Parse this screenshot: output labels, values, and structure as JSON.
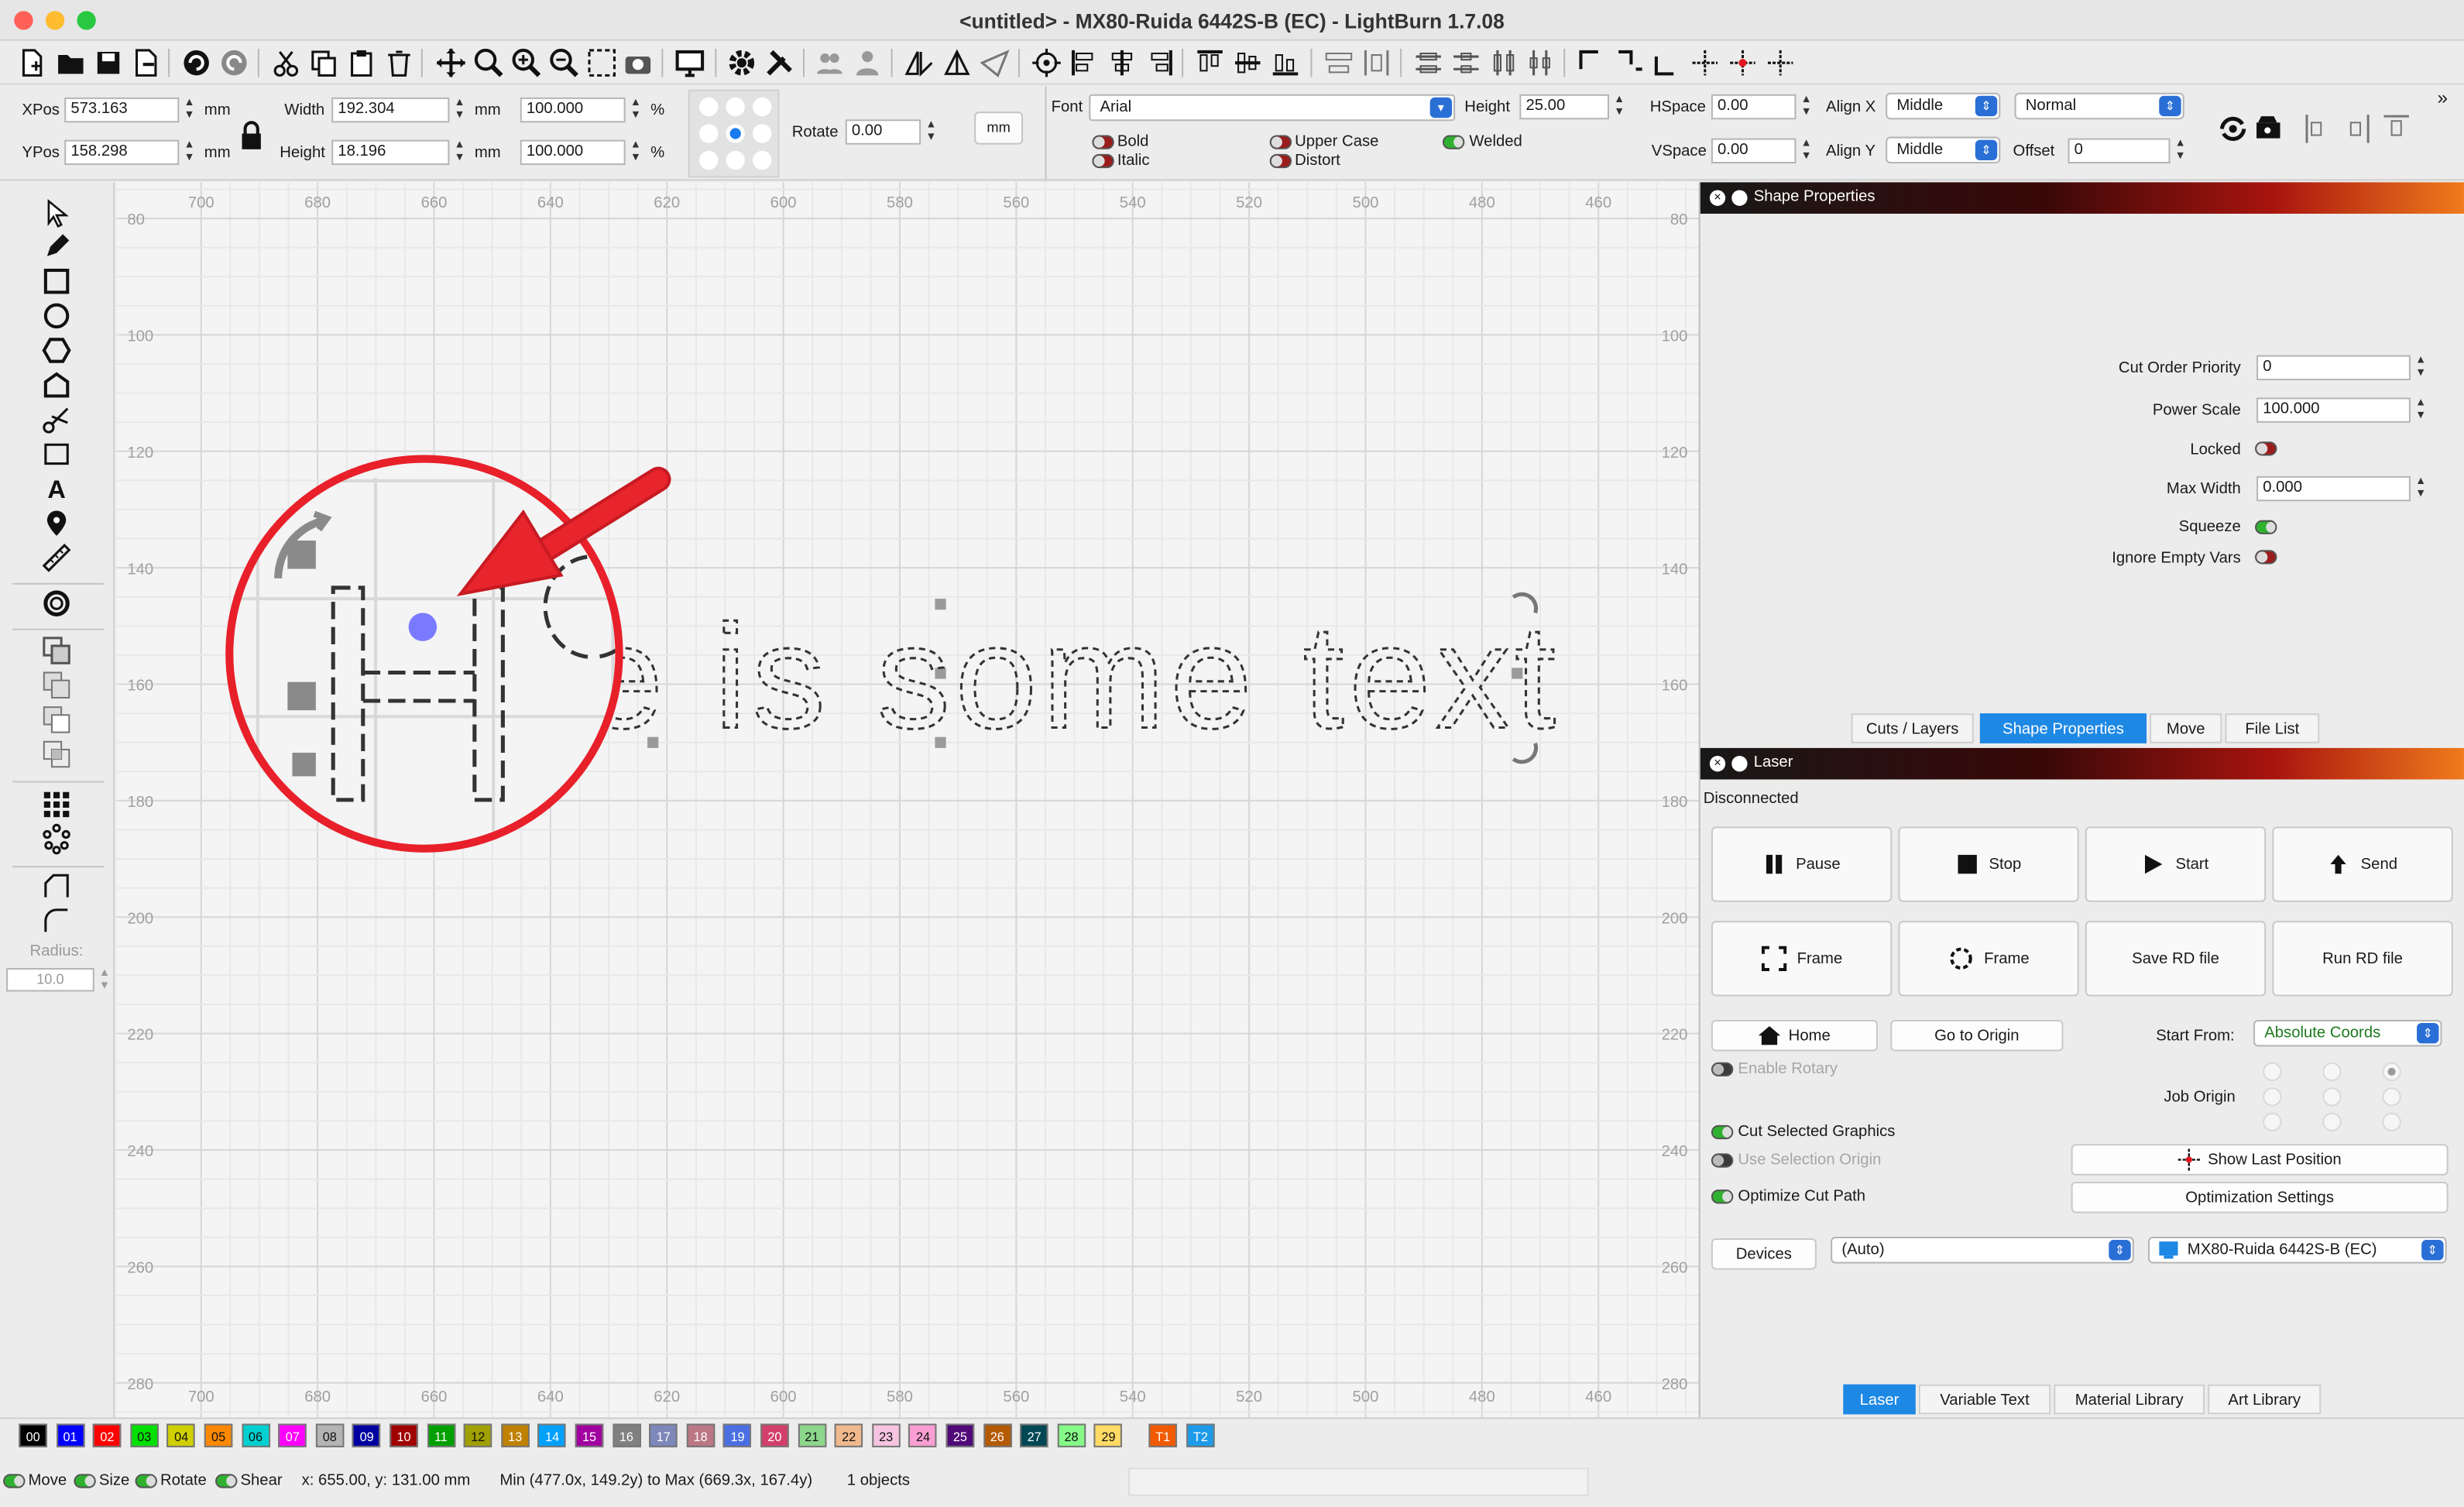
{
  "window": {
    "title": "<untitled> - MX80-Ruida 6442S-B (EC) - LightBurn 1.7.08"
  },
  "props": {
    "xpos_label": "XPos",
    "xpos": "573.163",
    "ypos_label": "YPos",
    "ypos": "158.298",
    "unit": "mm",
    "width_label": "Width",
    "width": "192.304",
    "height_label": "Height",
    "height": "18.196",
    "scale_w": "100.000",
    "scale_h": "100.000",
    "pct": "%",
    "rotate_label": "Rotate",
    "rotate": "0.00",
    "mm_button": "mm",
    "font_label": "Font",
    "font": "Arial",
    "font_height_label": "Height",
    "font_height": "25.00",
    "hspace_label": "HSpace",
    "hspace": "0.00",
    "vspace_label": "VSpace",
    "vspace": "0.00",
    "alignx_label": "Align X",
    "alignx": "Middle",
    "aligny_label": "Align Y",
    "aligny": "Middle",
    "mode": "Normal",
    "offset_label": "Offset",
    "offset": "0",
    "bold": "Bold",
    "italic": "Italic",
    "uppercase": "Upper Case",
    "distort": "Distort",
    "welded": "Welded"
  },
  "left_toolbar": {
    "radius_label": "Radius:",
    "radius": "10.0"
  },
  "canvas": {
    "x_ticks": [
      "700",
      "680",
      "660",
      "640",
      "620",
      "600",
      "580",
      "560",
      "540",
      "520",
      "500",
      "480",
      "460"
    ],
    "y_ticks": [
      "80",
      "100",
      "120",
      "140",
      "160",
      "180",
      "200",
      "220",
      "240",
      "260",
      "280"
    ],
    "text": "Here is some text"
  },
  "shape_properties": {
    "title": "Shape Properties",
    "cut_order_label": "Cut Order Priority",
    "cut_order": "0",
    "power_scale_label": "Power Scale",
    "power_scale": "100.000",
    "locked_label": "Locked",
    "max_width_label": "Max Width",
    "max_width": "0.000",
    "squeeze_label": "Squeeze",
    "ignore_empty_label": "Ignore Empty Vars",
    "tabs": [
      "Cuts / Layers",
      "Shape Properties",
      "Move",
      "File List"
    ]
  },
  "laser": {
    "title": "Laser",
    "status": "Disconnected",
    "pause": "Pause",
    "stop": "Stop",
    "start": "Start",
    "send": "Send",
    "frame1": "Frame",
    "frame2": "Frame",
    "save_rd": "Save RD file",
    "run_rd": "Run RD file",
    "home": "Home",
    "go_origin": "Go to Origin",
    "start_from_label": "Start From:",
    "start_from": "Absolute Coords",
    "enable_rotary": "Enable Rotary",
    "job_origin": "Job Origin",
    "cut_selected": "Cut Selected Graphics",
    "use_selection_origin": "Use Selection Origin",
    "show_last_position": "Show Last Position",
    "optimize_cut_path": "Optimize Cut Path",
    "optimization_settings": "Optimization Settings",
    "devices": "Devices",
    "device_auto": "(Auto)",
    "device_name": "MX80-Ruida 6442S-B (EC)",
    "tabs": [
      "Laser",
      "Variable Text",
      "Material Library",
      "Art Library"
    ]
  },
  "palette": {
    "labels": [
      "00",
      "01",
      "02",
      "03",
      "04",
      "05",
      "06",
      "07",
      "08",
      "09",
      "10",
      "11",
      "12",
      "13",
      "14",
      "15",
      "16",
      "17",
      "18",
      "19",
      "20",
      "21",
      "22",
      "23",
      "24",
      "25",
      "26",
      "27",
      "28",
      "29"
    ],
    "colors": [
      "#000000",
      "#0000ff",
      "#ff0000",
      "#00e000",
      "#d0d000",
      "#ff8800",
      "#00d0d0",
      "#ff00ff",
      "#b4b4b4",
      "#0000a0",
      "#a00000",
      "#00a000",
      "#a0a000",
      "#c08000",
      "#00a0ff",
      "#a000a0",
      "#808080",
      "#7d87b9",
      "#bb7784",
      "#4a6fe3",
      "#d33f6a",
      "#8cd78c",
      "#f0b98d",
      "#f6c4e1",
      "#fa9ed4",
      "#500a78",
      "#b45a00",
      "#004754",
      "#86fa88",
      "#ffdb66"
    ],
    "tools": [
      "T1",
      "T2"
    ],
    "tool_colors": [
      "#f25a00",
      "#1e9be8"
    ]
  },
  "status": {
    "move": "Move",
    "size": "Size",
    "rotate": "Rotate",
    "shear": "Shear",
    "coords": "x: 655.00, y: 131.00 mm",
    "bounds": "Min (477.0x, 149.2y) to Max (669.3x, 167.4y)",
    "objects": "1 objects"
  }
}
